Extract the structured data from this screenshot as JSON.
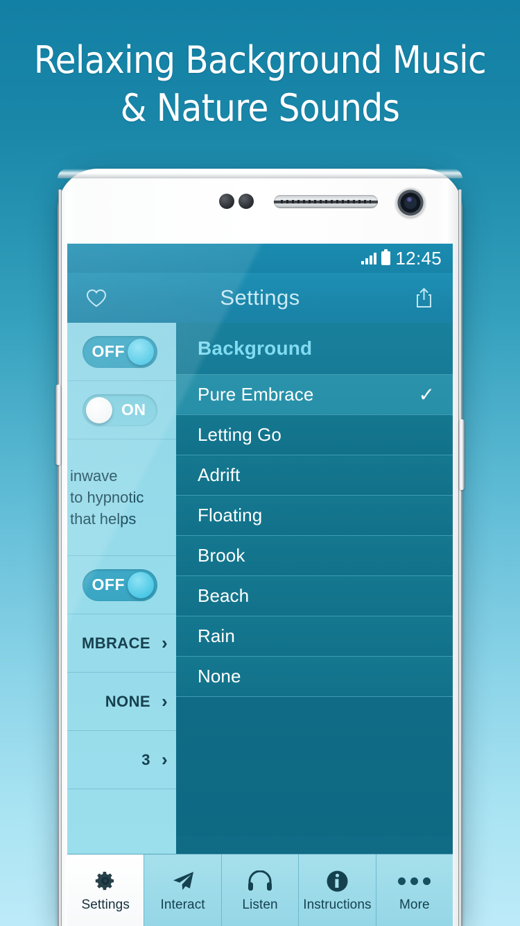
{
  "promo": {
    "line1": "Relaxing Background Music",
    "line2": "& Nature Sounds"
  },
  "colors": {
    "page_bg_top": "#1280a4",
    "page_bg_bottom": "#bdeaf8",
    "accent_header": "#1b87ab",
    "section_title": "#81dcf2",
    "selected_row": "#2a93ab",
    "left_pane": "#96dbea",
    "tab_active_bg": "#ffffff"
  },
  "status_bar": {
    "time": "12:45",
    "signal_icon": "signal-bars-icon",
    "battery_icon": "battery-full-icon"
  },
  "app_header": {
    "title": "Settings",
    "left_icon": "heart-icon",
    "right_icon": "share-icon"
  },
  "left_pane": {
    "rows": [
      {
        "type": "toggle",
        "state": "OFF"
      },
      {
        "type": "toggle",
        "state": "ON"
      },
      {
        "type": "text",
        "lines": [
          "inwave",
          "to hypnotic",
          "that helps"
        ]
      },
      {
        "type": "toggle",
        "state": "OFF"
      },
      {
        "type": "value",
        "value": "MBRACE",
        "chevron": "›"
      },
      {
        "type": "value",
        "value": "NONE",
        "chevron": "›"
      },
      {
        "type": "value",
        "value": "3",
        "chevron": "›"
      }
    ]
  },
  "background_list": {
    "section_title": "Background",
    "selected": "Pure Embrace",
    "check_glyph": "✓",
    "items": [
      {
        "label": "Pure Embrace",
        "selected": true
      },
      {
        "label": "Letting Go",
        "selected": false
      },
      {
        "label": "Adrift",
        "selected": false
      },
      {
        "label": "Floating",
        "selected": false
      },
      {
        "label": "Brook",
        "selected": false
      },
      {
        "label": "Beach",
        "selected": false
      },
      {
        "label": "Rain",
        "selected": false
      },
      {
        "label": "None",
        "selected": false
      }
    ]
  },
  "tab_bar": {
    "active": "Settings",
    "tabs": [
      {
        "label": "Settings",
        "icon": "gear-icon",
        "active": true
      },
      {
        "label": "Interact",
        "icon": "paper-plane-icon",
        "active": false
      },
      {
        "label": "Listen",
        "icon": "headphones-icon",
        "active": false
      },
      {
        "label": "Instructions",
        "icon": "info-circle-icon",
        "active": false
      },
      {
        "label": "More",
        "icon": "ellipsis-icon",
        "active": false
      }
    ]
  }
}
